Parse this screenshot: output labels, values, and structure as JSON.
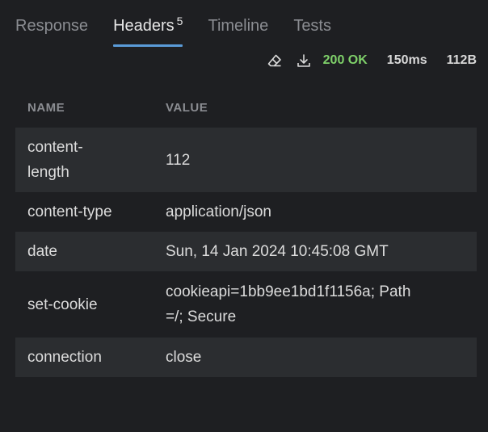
{
  "tabs": {
    "response": "Response",
    "headers": "Headers",
    "headers_count": "5",
    "timeline": "Timeline",
    "tests": "Tests"
  },
  "status": {
    "code": "200 OK",
    "time": "150ms",
    "size": "112B",
    "code_color": "#7fd16a"
  },
  "icons": {
    "clear": "eraser-icon",
    "download": "download-icon"
  },
  "table": {
    "columns": [
      "NAME",
      "VALUE"
    ],
    "rows": [
      {
        "name": "content-length",
        "value": "112"
      },
      {
        "name": "content-type",
        "value": "application/json"
      },
      {
        "name": "date",
        "value": "Sun, 14 Jan 2024 10:45:08 GMT"
      },
      {
        "name": "set-cookie",
        "value": "cookieapi=1bb9ee1bd1f1156a; Path=/; Secure"
      },
      {
        "name": "connection",
        "value": "close"
      }
    ]
  },
  "colors": {
    "background": "#1e1f22",
    "row_alt": "#2b2d30",
    "accent": "#5a9bd8"
  }
}
